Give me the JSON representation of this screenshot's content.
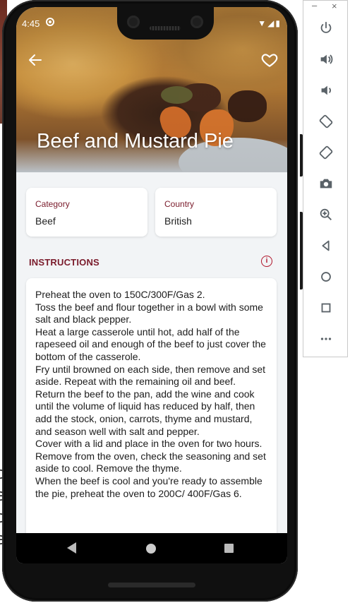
{
  "status_bar": {
    "time": "4:45",
    "icons": "▼◢▮"
  },
  "app_bar": {
    "back_icon": "arrow-left-icon",
    "favorite_icon": "heart-outline-icon"
  },
  "meal": {
    "title": "Beef and Mustard Pie",
    "category_label": "Category",
    "category_value": "Beef",
    "country_label": "Country",
    "country_value": "British"
  },
  "instructions": {
    "header": "INSTRUCTIONS",
    "info_icon": "info-circle-icon",
    "text": "Preheat the oven to 150C/300F/Gas 2.\nToss the beef and flour together in a bowl with some salt and black pepper.\nHeat a large casserole until hot, add half of the rapeseed oil and enough of the beef to just cover the bottom of the casserole.\nFry until browned on each side, then remove and set aside. Repeat with the remaining oil and beef.\nReturn the beef to the pan, add the wine and cook until the volume of liquid has reduced by half, then add the stock, onion, carrots, thyme and mustard, and season well with salt and pepper.\nCover with a lid and place in the oven for two hours.\nRemove from the oven, check the seasoning and set aside to cool. Remove the thyme.\nWhen the beef is cool and you're ready to assemble the pie, preheat the oven to 200C/ 400F/Gas 6."
  },
  "nav_bar": {
    "back": "nav-back-icon",
    "home": "nav-home-icon",
    "recents": "nav-recents-icon"
  },
  "emulator_toolbar": {
    "minimize": "–",
    "close": "×",
    "tools": [
      {
        "icon": "power-icon",
        "glyph": "⏻"
      },
      {
        "icon": "volume-up-icon",
        "glyph": "🔊"
      },
      {
        "icon": "volume-down-icon",
        "glyph": "🔉"
      },
      {
        "icon": "rotate-left-icon",
        "glyph": "⟲"
      },
      {
        "icon": "rotate-right-icon",
        "glyph": "⟳"
      },
      {
        "icon": "camera-icon",
        "glyph": "📷"
      },
      {
        "icon": "zoom-icon",
        "glyph": "⊕"
      },
      {
        "icon": "back-icon",
        "glyph": "◁"
      },
      {
        "icon": "home-icon",
        "glyph": "○"
      },
      {
        "icon": "overview-icon",
        "glyph": "□"
      },
      {
        "icon": "more-icon",
        "glyph": "•••"
      }
    ]
  }
}
